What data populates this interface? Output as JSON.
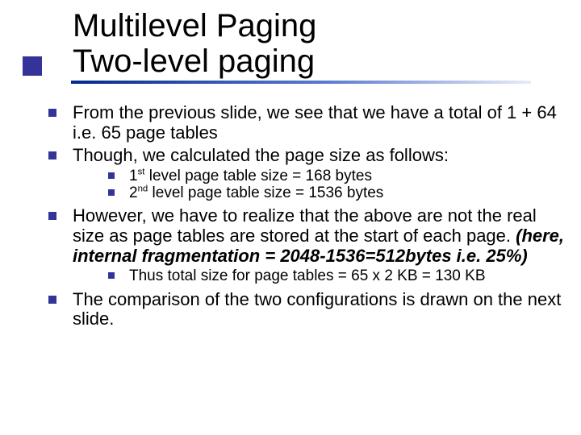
{
  "title": {
    "line1": "Multilevel Paging",
    "line2": "Two-level paging"
  },
  "bullets": {
    "b1": "From the previous slide, we see that we have a total of 1 + 64 i.e. 65 page tables",
    "b2": "Though, we calculated the page size as follows:",
    "b2_sub1_prefix": "1",
    "b2_sub1_sup": "st",
    "b2_sub1_rest": " level page table size =  168 bytes",
    "b2_sub2_prefix": "2",
    "b2_sub2_sup": "nd",
    "b2_sub2_rest": " level page table size = 1536 bytes",
    "b3_text": "However, we have to realize that the above are not the real size as page tables are stored at the start of each page. ",
    "b3_frag": "(here, internal fragmentation = 2048-1536=512bytes i.e. 25%)",
    "b3_sub1": "Thus total size for page tables = 65 x 2 KB = 130 KB",
    "b4": "The comparison of the two configurations is drawn on the next slide."
  }
}
